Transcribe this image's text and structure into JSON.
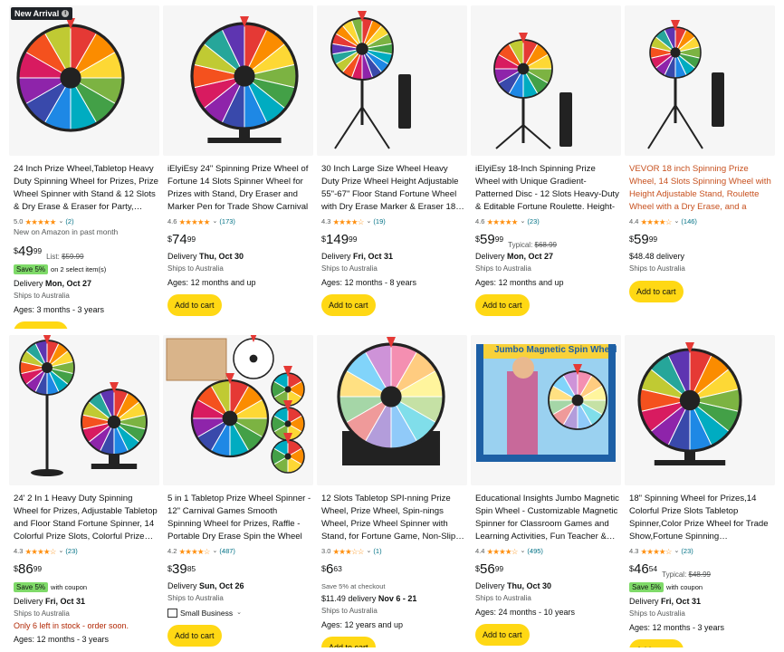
{
  "badge_new": "New Arrival",
  "add_to_cart": "Add to cart",
  "products": [
    {
      "title": "24 Inch Prize Wheel,Tabletop Heavy Duty Spinning Wheel for Prizes, Prize Wheel Spinner with Stand & 12 Slots & Dry Erase & Eraser for Party,…",
      "rating": "5.0",
      "stars": "★★★★★",
      "count": "(2)",
      "note_top": "New on Amazon in past month",
      "price_whole": "49",
      "price_frac": "99",
      "list_label": "List:",
      "list_price": "$59.99",
      "save_badge": "Save 5%",
      "save_text": "on 2 select item(s)",
      "delivery_label": "Delivery",
      "delivery_date": "Mon, Oct 27",
      "ships": "Ships to Australia",
      "ages": "Ages: 3 months - 3 years"
    },
    {
      "title": "iElyiEsy 24\" Spinning Prize Wheel of Fortune 14 Slots Spinner Wheel for Prizes with Stand, Dry Eraser and Marker Pen for Trade Show Carnival",
      "rating": "4.6",
      "stars": "★★★★★",
      "count": "(173)",
      "price_whole": "74",
      "price_frac": "99",
      "delivery_label": "Delivery",
      "delivery_date": "Thu, Oct 30",
      "ships": "Ships to Australia",
      "ages": "Ages: 12 months and up"
    },
    {
      "title": "30 Inch Large Size Wheel Heavy Duty Prize Wheel Height Adjustable 55\"-67\" Floor Stand Fortune Wheel with Dry Erase Marker & Eraser 18…",
      "rating": "4.3",
      "stars": "★★★★☆",
      "count": "(19)",
      "price_whole": "149",
      "price_frac": "99",
      "delivery_label": "Delivery",
      "delivery_date": "Fri, Oct 31",
      "ships": "Ships to Australia",
      "ages": "Ages: 12 months - 8 years"
    },
    {
      "title": "iElyiEsy 18-Inch Spinning Prize Wheel with Unique Gradient-Patterned Disc - 12 Slots Heavy-Duty & Editable Fortune Roulette. Height-Adjustabl…",
      "rating": "4.6",
      "stars": "★★★★★",
      "count": "(23)",
      "price_whole": "59",
      "price_frac": "99",
      "list_label": "Typical:",
      "list_price": "$68.99",
      "delivery_label": "Delivery",
      "delivery_date": "Mon, Oct 27",
      "ships": "Ships to Australia",
      "ages": "Ages: 12 months and up"
    },
    {
      "title": "VEVOR 18 inch Spinning Prize Wheel, 14 Slots Spinning Wheel with Height Adjustable Stand, Roulette Wheel with a Dry Erase, and a Storage Ba…",
      "rating": "4.4",
      "stars": "★★★★☆",
      "count": "(146)",
      "price_whole": "59",
      "price_frac": "99",
      "delivery_fee": "$48.48 delivery",
      "ships": "Ships to Australia"
    },
    {
      "title": "24' 2 In 1 Heavy Duty Spinning Wheel for Prizes, Adjustable Tabletop and Floor Stand Fortune Spinner, 14 Colorful Prize Slots, Colorful Prize…",
      "rating": "4.3",
      "stars": "★★★★☆",
      "count": "(23)",
      "price_whole": "86",
      "price_frac": "99",
      "save_badge": "Save 5%",
      "save_text": "with coupon",
      "delivery_label": "Delivery",
      "delivery_date": "Fri, Oct 31",
      "ships": "Ships to Australia",
      "stock": "Only 6 left in stock - order soon.",
      "ages": "Ages: 12 months - 3 years"
    },
    {
      "title": "5 in 1 Tabletop Prize Wheel Spinner - 12\" Carnival Games Smooth Spinning Wheel for Prizes, Raffle - Portable Dry Erase Spin the Wheel Game wit…",
      "rating": "4.2",
      "stars": "★★★★☆",
      "count": "(487)",
      "price_whole": "39",
      "price_frac": "85",
      "delivery_label": "Delivery",
      "delivery_date": "Sun, Oct 26",
      "ships": "Ships to Australia",
      "small_business": "Small Business"
    },
    {
      "title": "12 Slots Tabletop SPI-nning Prize Wheel, Prize Wheel, Spin-nings Wheel, Prize Wheel Spinner with Stand, for Fortune Game, Non-Slip…",
      "rating": "3.0",
      "stars": "★★★☆☆",
      "count": "(1)",
      "price_whole": "6",
      "price_frac": "63",
      "checkout_note": "Save 5% at checkout",
      "delivery_fee": "$11.49 delivery",
      "delivery_range": "Nov 6 - 21",
      "ships": "Ships to Australia",
      "ages": "Ages: 12 years and up"
    },
    {
      "title": "Educational Insights Jumbo Magnetic Spin Wheel - Customizable Magnetic Spinner for Classroom Games and Learning Activities, Fun Teacher &…",
      "rating": "4.4",
      "stars": "★★★★☆",
      "count": "(495)",
      "price_whole": "56",
      "price_frac": "99",
      "delivery_label": "Delivery",
      "delivery_date": "Thu, Oct 30",
      "ships": "Ships to Australia",
      "ages": "Ages: 24 months - 10 years",
      "box_text": "Jumbo Magnetic Spin Wheel"
    },
    {
      "title": "18\" Spinning Wheel for Prizes,14 Colorful Prize Slots Tabletop Spinner,Color Prize Wheel for Trade Show,Fortune Spinning…",
      "rating": "4.3",
      "stars": "★★★★☆",
      "count": "(23)",
      "price_whole": "46",
      "price_frac": "54",
      "list_label": "Typical:",
      "list_price": "$48.99",
      "save_badge": "Save 5%",
      "save_text": "with coupon",
      "delivery_label": "Delivery",
      "delivery_date": "Fri, Oct 31",
      "ships": "Ships to Australia",
      "ages": "Ages: 12 months - 3 years"
    }
  ]
}
